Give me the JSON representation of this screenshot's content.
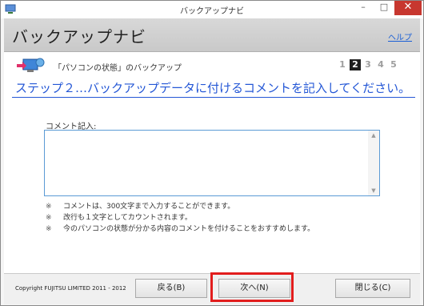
{
  "window": {
    "title": "バックアップナビ",
    "controls": {
      "minimize": "–",
      "maximize": "□",
      "close": "✕"
    }
  },
  "header": {
    "title": "バックアップナビ",
    "help_link": "ヘルプ"
  },
  "section": {
    "label": "「パソコンの状態」のバックアップ",
    "steps": [
      "1",
      "2",
      "3",
      "4",
      "5"
    ],
    "current_step": 2,
    "headline": "ステップ２…バックアップデータに付けるコメントを記入してください。"
  },
  "comment": {
    "label": "コメント記入:",
    "value": ""
  },
  "notes": [
    {
      "mark": "※",
      "text": "コメントは、300文字まで入力することができます。"
    },
    {
      "mark": "※",
      "text": "改行も１文字としてカウントされます。"
    },
    {
      "mark": "※",
      "text": "今のパソコンの状態が分かる内容のコメントを付けることをおすすめします。"
    }
  ],
  "footer": {
    "copyright": "Copyright FUJITSU LIMITED 2011 - 2012",
    "back_label": "戻る(B)",
    "next_label": "次へ(N)",
    "close_label": "閉じる(C)"
  },
  "colors": {
    "accent": "#2457d6",
    "highlight": "#e21d1d",
    "header_bg": "#cfcfcf"
  }
}
